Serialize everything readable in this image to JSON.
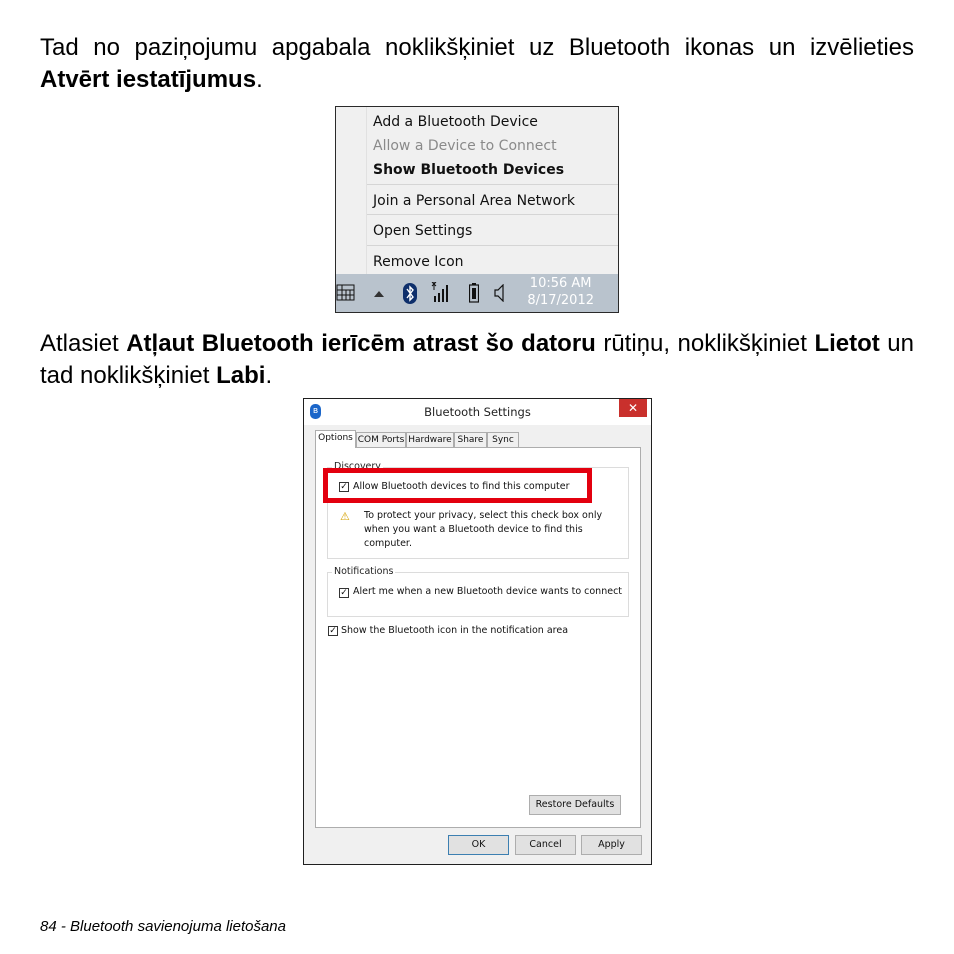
{
  "paragraph1": {
    "t1": "Tad no paziņojumu apgabala noklikšķiniet uz Bluetooth ikonas un izvēlieties ",
    "b1": "Atvērt iestatījumus",
    "t2": "."
  },
  "paragraph2": {
    "t1": "Atlasiet ",
    "b1": "Atļaut Bluetooth ierīcēm atrast šo datoru",
    "t2": " rūtiņu, noklikšķiniet ",
    "b2": "Lietot",
    "t3": " un tad noklikšķiniet ",
    "b3": "Labi",
    "t4": "."
  },
  "context_menu": {
    "items": [
      "Add a Bluetooth Device",
      "Allow a Device to Connect",
      "Show Bluetooth Devices",
      "Join a Personal Area Network",
      "Open Settings",
      "Remove Icon"
    ]
  },
  "taskbar": {
    "time": "10:56 AM",
    "date": "8/17/2012",
    "icons": [
      "keyboard-icon",
      "chevron-up-icon",
      "bluetooth-icon",
      "signal-icon",
      "battery-icon",
      "speaker-icon"
    ],
    "background": "#b9c3cd"
  },
  "dialog": {
    "title": "Bluetooth Settings",
    "close_glyph": "✕",
    "tabs": [
      "Options",
      "COM Ports",
      "Hardware",
      "Share",
      "Sync"
    ],
    "discovery_label": "Discovery",
    "allow_discovery": "Allow Bluetooth devices to find this computer",
    "privacy_note_lines": [
      "To protect your privacy, select this check box only",
      "when you want a Bluetooth device to find this",
      "computer."
    ],
    "notifications_label": "Notifications",
    "alert_new_device": "Alert me when a new Bluetooth device wants to connect",
    "show_icon": "Show the Bluetooth icon in the notification area",
    "restore_defaults": "Restore Defaults",
    "ok": "OK",
    "cancel": "Cancel",
    "apply": "Apply",
    "check_glyph": "✓",
    "warning_glyph": "⚠",
    "highlight_color": "#e3000f"
  },
  "footer": "84 - Bluetooth savienojuma lietošana"
}
